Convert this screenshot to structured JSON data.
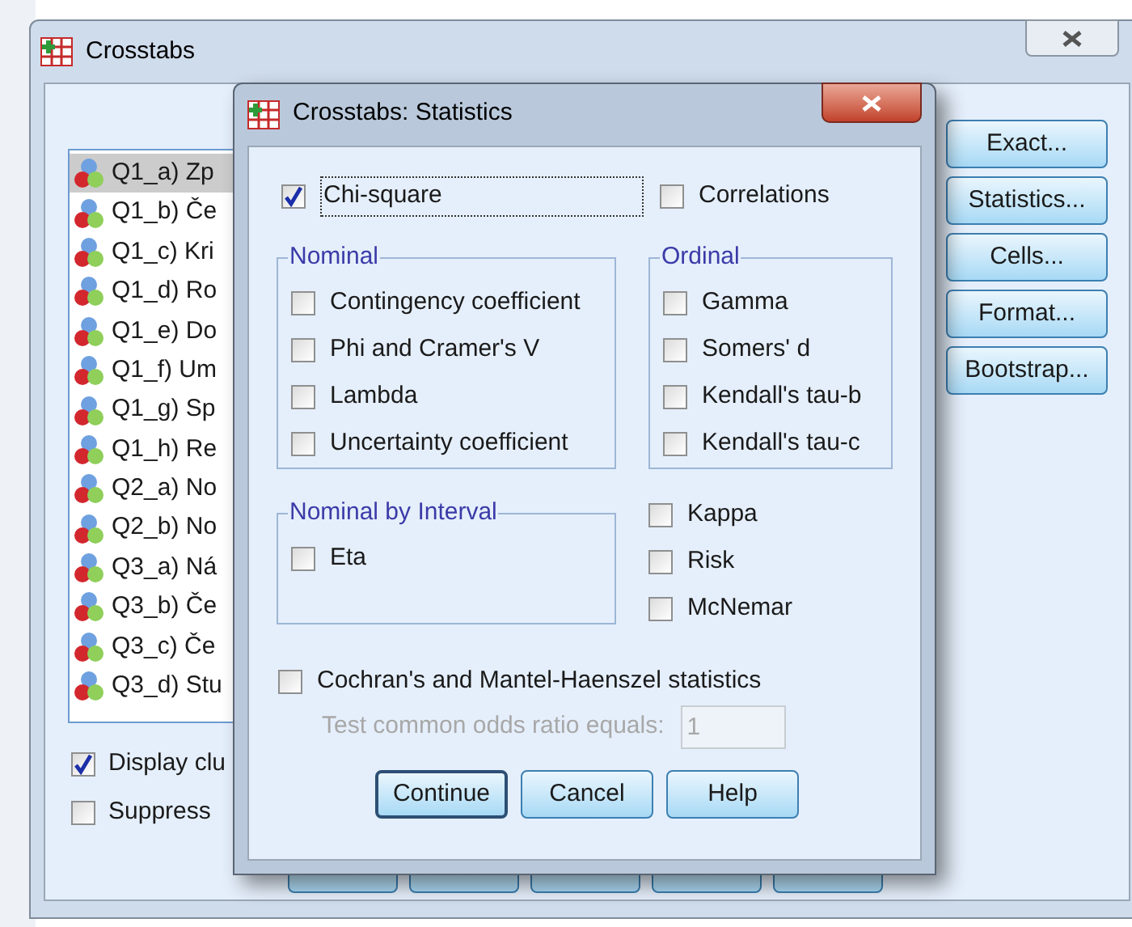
{
  "background_window": {
    "title": "Crosstabs",
    "variables": [
      {
        "label": "Q1_a) Zp",
        "selected": true
      },
      {
        "label": "Q1_b) Če",
        "selected": false
      },
      {
        "label": "Q1_c) Kri",
        "selected": false
      },
      {
        "label": "Q1_d) Ro",
        "selected": false
      },
      {
        "label": "Q1_e) Do",
        "selected": false
      },
      {
        "label": "Q1_f) Um",
        "selected": false
      },
      {
        "label": "Q1_g) Sp",
        "selected": false
      },
      {
        "label": "Q1_h) Re",
        "selected": false
      },
      {
        "label": "Q2_a) No",
        "selected": false
      },
      {
        "label": "Q2_b) No",
        "selected": false
      },
      {
        "label": "Q3_a) Ná",
        "selected": false
      },
      {
        "label": "Q3_b) Če",
        "selected": false
      },
      {
        "label": "Q3_c) Če",
        "selected": false
      },
      {
        "label": "Q3_d) Stu",
        "selected": false
      }
    ],
    "options": [
      {
        "label": "Display clu",
        "checked": true
      },
      {
        "label": "Suppress",
        "checked": false
      }
    ],
    "side_buttons": [
      "Exact...",
      "Statistics...",
      "Cells...",
      "Format...",
      "Bootstrap..."
    ]
  },
  "dialog": {
    "title": "Crosstabs: Statistics",
    "chi_square": {
      "label": "Chi-square",
      "checked": true
    },
    "correlations": {
      "label": "Correlations",
      "checked": false
    },
    "nominal": {
      "title": "Nominal",
      "items": [
        {
          "label": "Contingency coefficient",
          "checked": false
        },
        {
          "label": "Phi and Cramer's V",
          "checked": false
        },
        {
          "label": "Lambda",
          "checked": false
        },
        {
          "label": "Uncertainty coefficient",
          "checked": false
        }
      ]
    },
    "ordinal": {
      "title": "Ordinal",
      "items": [
        {
          "label": "Gamma",
          "checked": false
        },
        {
          "label": "Somers' d",
          "checked": false
        },
        {
          "label": "Kendall's tau-b",
          "checked": false
        },
        {
          "label": "Kendall's tau-c",
          "checked": false
        }
      ]
    },
    "nominal_by_interval": {
      "title": "Nominal by Interval",
      "items": [
        {
          "label": "Eta",
          "checked": false
        }
      ]
    },
    "other": [
      {
        "label": "Kappa",
        "checked": false
      },
      {
        "label": "Risk",
        "checked": false
      },
      {
        "label": "McNemar",
        "checked": false
      }
    ],
    "cochran": {
      "label": "Cochran's and Mantel-Haenszel statistics",
      "checked": false
    },
    "odds_ratio": {
      "label": "Test common odds ratio equals:",
      "value": "1",
      "disabled": true
    },
    "buttons": [
      {
        "label": "Continue",
        "default": true
      },
      {
        "label": "Cancel",
        "default": false
      },
      {
        "label": "Help",
        "default": false
      }
    ]
  }
}
